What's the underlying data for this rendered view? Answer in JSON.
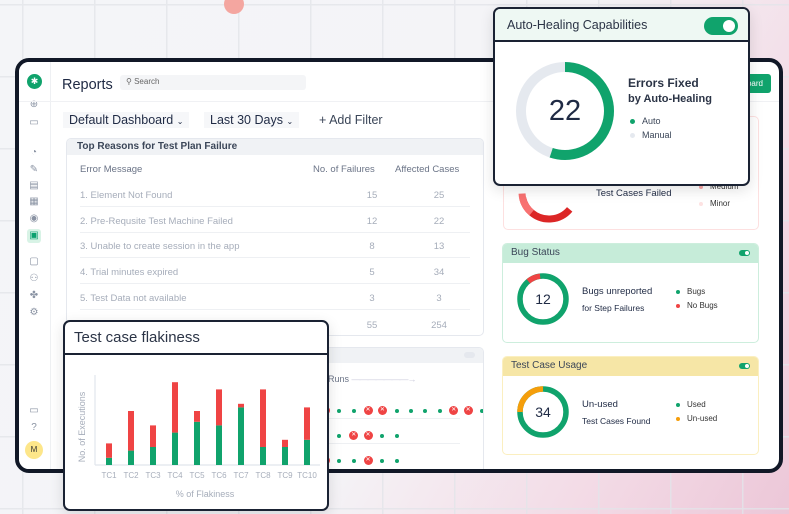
{
  "header": {
    "title": "Reports",
    "search_placeholder": "Search",
    "button_label": "Dashboard"
  },
  "filters": {
    "dashboard": "Default Dashboard",
    "range": "Last 30 Days",
    "add_filter": "+ Add Filter"
  },
  "sidebar": {
    "avatar": "M",
    "icons": [
      "plus-circle-icon",
      "monitor-icon",
      "gauge-icon",
      "pen-icon",
      "folder-icon",
      "grid-icon",
      "target-icon",
      "report-icon",
      "chat-icon",
      "users-icon",
      "puzzle-icon",
      "gear-icon"
    ],
    "bottom_icons": [
      "briefcase-icon",
      "help-icon"
    ]
  },
  "table": {
    "title": "Top Reasons for Test Plan Failure",
    "columns": [
      "Error Message",
      "No. of Failures",
      "Affected Cases"
    ],
    "rows": [
      [
        "1. Element Not Found",
        "15",
        "25"
      ],
      [
        "2. Pre-Requsite Test Machine Failed",
        "12",
        "22"
      ],
      [
        "3. Unable to create session in the app",
        "8",
        "13"
      ],
      [
        "4. Trial minutes expired",
        "5",
        "34"
      ],
      [
        "5. Test Data not available",
        "3",
        "3"
      ]
    ],
    "totals": [
      "55",
      "254"
    ]
  },
  "runs": {
    "label": "Runs",
    "rows": [
      [
        "f",
        "o",
        "o",
        "f",
        "f",
        "o",
        "o",
        "o",
        "o",
        "f",
        "f",
        "o",
        "f"
      ],
      [
        "o",
        "o",
        "f",
        "f",
        "o",
        "o"
      ],
      [
        "f",
        "o",
        "o",
        "f",
        "o",
        "o"
      ]
    ]
  },
  "failed_card": {
    "label": "Test Cases Failed",
    "legend": [
      "Medium",
      "Minor"
    ]
  },
  "auto_healing": {
    "title": "Auto-Healing Capabilities",
    "value": "22",
    "line1": "Errors Fixed",
    "line2": "by Auto-Healing",
    "legend": [
      "Auto",
      "Manual"
    ],
    "auto_fraction": 0.55,
    "enabled": true
  },
  "bug_status": {
    "title": "Bug Status",
    "value": "12",
    "line1": "Bugs unreported",
    "line2": "for Step Failures",
    "legend": [
      "Bugs",
      "No Bugs"
    ],
    "no_bugs_fraction": 0.09,
    "enabled": true
  },
  "usage": {
    "title": "Test Case Usage",
    "value": "34",
    "line1": "Un-used",
    "line2": "Test Cases Found",
    "legend": [
      "Used",
      "Un-used"
    ],
    "unused_fraction": 0.25,
    "enabled": true
  },
  "colors": {
    "green": "#10a36c",
    "red": "#ef4444",
    "orange": "#f59e0b",
    "grey": "#e5e9ef"
  },
  "flakiness": {
    "title": "Test case flakiness",
    "chart_data": {
      "type": "bar",
      "stacked": true,
      "categories": [
        "TC1",
        "TC2",
        "TC3",
        "TC4",
        "TC5",
        "TC6",
        "TC7",
        "TC8",
        "TC9",
        "TC10"
      ],
      "series": [
        {
          "color": "#10a36c",
          "values": [
            2,
            4,
            5,
            9,
            12,
            11,
            16,
            5,
            5,
            7
          ]
        },
        {
          "color": "#ef4444",
          "values": [
            4,
            11,
            6,
            14,
            3,
            10,
            1,
            16,
            2,
            9
          ]
        }
      ],
      "xlabel": "% of Flakiness",
      "ylabel": "No. of Executions",
      "ylim": [
        0,
        25
      ],
      "grid": false
    }
  }
}
